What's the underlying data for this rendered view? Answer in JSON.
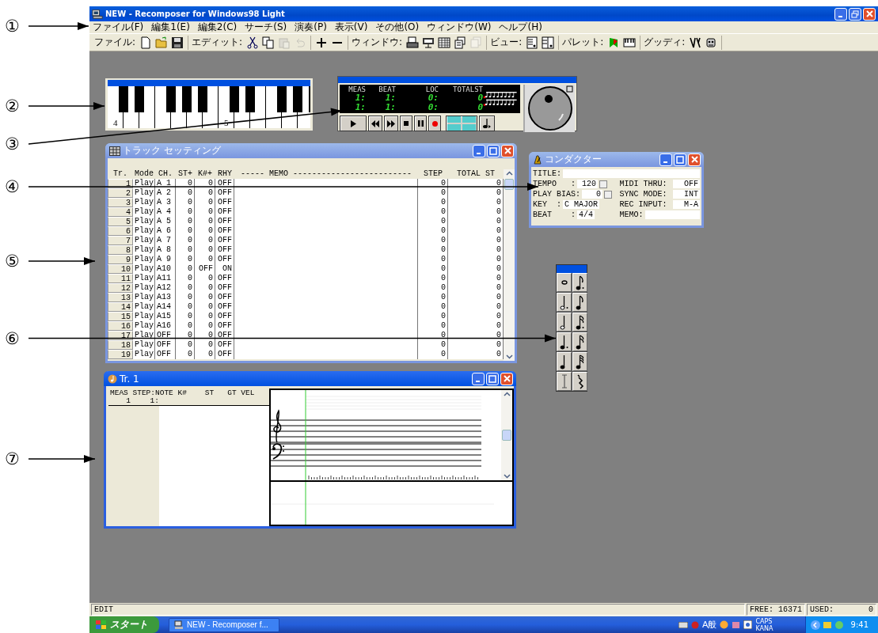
{
  "annotations": [
    {
      "label": "①"
    },
    {
      "label": "②"
    },
    {
      "label": "③"
    },
    {
      "label": "④"
    },
    {
      "label": "⑤"
    },
    {
      "label": "⑥"
    },
    {
      "label": "⑦"
    }
  ],
  "window": {
    "title": "NEW - Recomposer for Windows98 Light"
  },
  "menu": {
    "items": [
      "ファイル(F)",
      "編集1(E)",
      "編集2(C)",
      "サーチ(S)",
      "演奏(P)",
      "表示(V)",
      "その他(O)",
      "ウィンドウ(W)",
      "ヘルプ(H)"
    ]
  },
  "toolbar": [
    {
      "kind": "file",
      "label": "ファイル:",
      "buttons": [
        {
          "disabled": false
        },
        {
          "disabled": false
        },
        {
          "disabled": false
        }
      ]
    },
    {
      "kind": "edit",
      "label": "エディット:",
      "buttons": [
        {
          "disabled": false
        },
        {
          "disabled": false
        },
        {
          "disabled": true
        },
        {
          "disabled": true
        }
      ]
    },
    {
      "kind": "plusminus",
      "buttons": [
        {
          "disabled": false
        },
        {
          "disabled": false
        }
      ]
    },
    {
      "kind": "window",
      "label": "ウィンドウ:",
      "buttons": [
        {
          "disabled": false
        },
        {
          "disabled": false
        },
        {
          "disabled": false
        },
        {
          "disabled": false
        },
        {
          "disabled": true
        }
      ]
    },
    {
      "kind": "view",
      "label": "ビュー:",
      "buttons": [
        {
          "disabled": false
        },
        {
          "disabled": false
        }
      ]
    },
    {
      "kind": "palette",
      "label": "パレット:",
      "buttons": [
        {
          "disabled": false
        },
        {
          "disabled": false
        }
      ]
    },
    {
      "kind": "guide",
      "label": "グッディ:",
      "buttons": [
        {
          "disabled": false
        },
        {
          "disabled": false
        }
      ]
    }
  ],
  "keyboard": {
    "octave_labels": [
      "4",
      "5"
    ]
  },
  "transport": {
    "headers": [
      "MEAS",
      "BEAT",
      "LOC",
      "TOTALST"
    ],
    "rows": [
      [
        "1:",
        "1:",
        "0:",
        "0"
      ],
      [
        "1:",
        "1:",
        "0:",
        "0"
      ]
    ]
  },
  "track_settings": {
    "title": "トラック セッティング",
    "columns": [
      "Tr.",
      "Mode",
      "CH.",
      "ST+",
      "K#+",
      "RHY",
      "----- MEMO -------------------------",
      "STEP",
      "TOTAL ST"
    ],
    "rows": [
      [
        "1",
        "Play",
        "A 1",
        "0",
        "0",
        "OFF",
        "",
        "0",
        "0"
      ],
      [
        "2",
        "Play",
        "A 2",
        "0",
        "0",
        "OFF",
        "",
        "0",
        "0"
      ],
      [
        "3",
        "Play",
        "A 3",
        "0",
        "0",
        "OFF",
        "",
        "0",
        "0"
      ],
      [
        "4",
        "Play",
        "A 4",
        "0",
        "0",
        "OFF",
        "",
        "0",
        "0"
      ],
      [
        "5",
        "Play",
        "A 5",
        "0",
        "0",
        "OFF",
        "",
        "0",
        "0"
      ],
      [
        "6",
        "Play",
        "A 6",
        "0",
        "0",
        "OFF",
        "",
        "0",
        "0"
      ],
      [
        "7",
        "Play",
        "A 7",
        "0",
        "0",
        "OFF",
        "",
        "0",
        "0"
      ],
      [
        "8",
        "Play",
        "A 8",
        "0",
        "0",
        "OFF",
        "",
        "0",
        "0"
      ],
      [
        "9",
        "Play",
        "A 9",
        "0",
        "0",
        "OFF",
        "",
        "0",
        "0"
      ],
      [
        "10",
        "Play",
        "A10",
        "0",
        "OFF",
        "ON",
        "",
        "0",
        "0"
      ],
      [
        "11",
        "Play",
        "A11",
        "0",
        "0",
        "OFF",
        "",
        "0",
        "0"
      ],
      [
        "12",
        "Play",
        "A12",
        "0",
        "0",
        "OFF",
        "",
        "0",
        "0"
      ],
      [
        "13",
        "Play",
        "A13",
        "0",
        "0",
        "OFF",
        "",
        "0",
        "0"
      ],
      [
        "14",
        "Play",
        "A14",
        "0",
        "0",
        "OFF",
        "",
        "0",
        "0"
      ],
      [
        "15",
        "Play",
        "A15",
        "0",
        "0",
        "OFF",
        "",
        "0",
        "0"
      ],
      [
        "16",
        "Play",
        "A16",
        "0",
        "0",
        "OFF",
        "",
        "0",
        "0"
      ],
      [
        "17",
        "Play",
        "OFF",
        "0",
        "0",
        "OFF",
        "",
        "0",
        "0"
      ],
      [
        "18",
        "Play",
        "OFF",
        "0",
        "0",
        "OFF",
        "",
        "0",
        "0"
      ],
      [
        "19",
        "Play",
        "OFF",
        "0",
        "0",
        "OFF",
        "",
        "0",
        "0"
      ]
    ]
  },
  "conductor": {
    "title": "コンダクター",
    "title_label": "TITLE:",
    "left": [
      {
        "label": "TEMPO   :",
        "value": "120",
        "kind": "spin"
      },
      {
        "label": "PLAY BIAS:",
        "value": "0",
        "kind": "spin"
      },
      {
        "label": "KEY  :",
        "value": "C MAJOR",
        "kind": "plain"
      },
      {
        "label": "BEAT    :",
        "value": "4/4",
        "kind": "plain"
      }
    ],
    "right": [
      {
        "label": "MIDI THRU:",
        "value": "OFF"
      },
      {
        "label": "SYNC MODE:",
        "value": "INT"
      },
      {
        "label": "REC INPUT:",
        "value": "M-A"
      },
      {
        "label": "MEMO:"
      }
    ]
  },
  "track_editor": {
    "title": "Tr. 1",
    "header": "MEAS STEP:NOTE K#    ST   GT VEL",
    "rows": [
      {
        "meas": "1",
        "step": "1:"
      }
    ]
  },
  "status_bar": {
    "mode": "EDIT",
    "free": "FREE: 16371",
    "used_label": "USED:",
    "used": "0"
  },
  "taskbar": {
    "start": "スタート",
    "tasks": [
      "NEW - Recomposer f..."
    ],
    "ime": "A般",
    "caps": "CAPS",
    "kana": "KANA",
    "clock": "9:41"
  }
}
